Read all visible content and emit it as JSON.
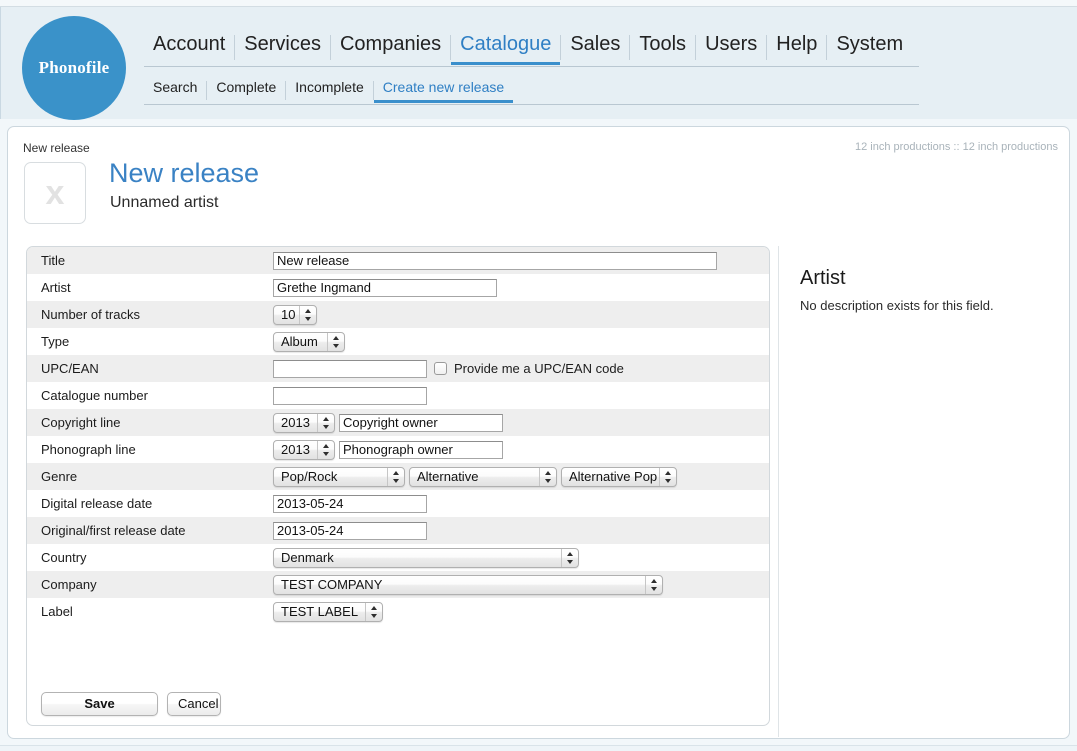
{
  "brand": {
    "logo_text": "Phonofile",
    "accent_color": "#3a8fcc",
    "link_color": "#3a82c4"
  },
  "nav": {
    "primary": [
      {
        "label": "Account",
        "active": false
      },
      {
        "label": "Services",
        "active": false
      },
      {
        "label": "Companies",
        "active": false
      },
      {
        "label": "Catalogue",
        "active": true
      },
      {
        "label": "Sales",
        "active": false
      },
      {
        "label": "Tools",
        "active": false
      },
      {
        "label": "Users",
        "active": false
      },
      {
        "label": "Help",
        "active": false
      },
      {
        "label": "System",
        "active": false
      }
    ],
    "secondary": [
      {
        "label": "Search",
        "active": false
      },
      {
        "label": "Complete",
        "active": false
      },
      {
        "label": "Incomplete",
        "active": false
      },
      {
        "label": "Create new release",
        "active": true
      }
    ]
  },
  "page": {
    "breadcrumb": "New release",
    "org_path": "12 inch productions :: 12 inch productions",
    "release_title": "New release",
    "release_artist": "Unnamed artist",
    "cover_placeholder_glyph": "x"
  },
  "form": {
    "rows": {
      "title": {
        "label": "Title",
        "value": "New release"
      },
      "artist": {
        "label": "Artist",
        "value": "Grethe Ingmand"
      },
      "number_of_tracks": {
        "label": "Number of tracks",
        "value": "10"
      },
      "type": {
        "label": "Type",
        "value": "Album"
      },
      "upc_ean": {
        "label": "UPC/EAN",
        "value": "",
        "checkbox_label": "Provide me a UPC/EAN code",
        "checked": false
      },
      "catalogue_number": {
        "label": "Catalogue number",
        "value": ""
      },
      "copyright_line": {
        "label": "Copyright line",
        "year": "2013",
        "owner": "Copyright owner"
      },
      "phonograph_line": {
        "label": "Phonograph line",
        "year": "2013",
        "owner": "Phonograph owner"
      },
      "genre": {
        "label": "Genre",
        "level1": "Pop/Rock",
        "level2": "Alternative",
        "level3": "Alternative Pop"
      },
      "digital_release_date": {
        "label": "Digital release date",
        "value": "2013-05-24"
      },
      "original_release_date": {
        "label": "Original/first release date",
        "value": "2013-05-24"
      },
      "country": {
        "label": "Country",
        "value": "Denmark"
      },
      "company": {
        "label": "Company",
        "value": "TEST COMPANY"
      },
      "label": {
        "label": "Label",
        "value": "TEST LABEL"
      }
    }
  },
  "actions": {
    "save_label": "Save",
    "cancel_label": "Cancel"
  },
  "info_pane": {
    "title": "Artist",
    "text": "No description exists for this field."
  }
}
